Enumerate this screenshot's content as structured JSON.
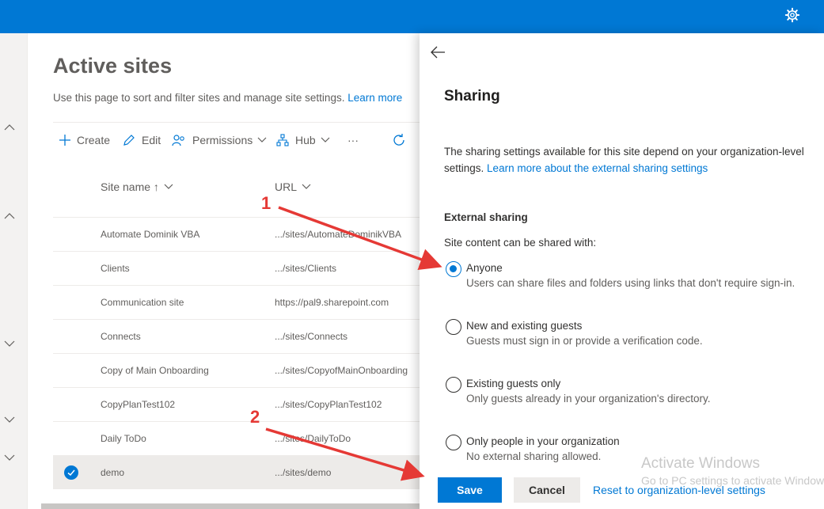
{
  "topbar": {
    "settings_icon": "gear-icon",
    "color": "#0078d4"
  },
  "main": {
    "title": "Active sites",
    "description": "Use this page to sort and filter sites and manage site settings.",
    "learn_more": "Learn more",
    "toolbar": {
      "create": "Create",
      "edit": "Edit",
      "permissions": "Permissions",
      "hub": "Hub",
      "more": "···"
    },
    "columns": {
      "site_name": "Site name ↑",
      "url": "URL"
    },
    "rows": [
      {
        "name": "Automate Dominik VBA",
        "url": ".../sites/AutomateDominikVBA",
        "selected": false
      },
      {
        "name": "Clients",
        "url": ".../sites/Clients",
        "selected": false
      },
      {
        "name": "Communication site",
        "url": "https://pal9.sharepoint.com",
        "selected": false
      },
      {
        "name": "Connects",
        "url": ".../sites/Connects",
        "selected": false
      },
      {
        "name": "Copy of Main Onboarding",
        "url": ".../sites/CopyofMainOnboarding",
        "selected": false
      },
      {
        "name": "CopyPlanTest102",
        "url": ".../sites/CopyPlanTest102",
        "selected": false
      },
      {
        "name": "Daily ToDo",
        "url": ".../sites/DailyToDo",
        "selected": false
      },
      {
        "name": "demo",
        "url": ".../sites/demo",
        "selected": true
      }
    ]
  },
  "panel": {
    "title": "Sharing",
    "description": "The sharing settings available for this site depend on your organization-level settings.",
    "description_link": "Learn more about the external sharing settings",
    "section": "External sharing",
    "group_label": "Site content can be shared with:",
    "options": [
      {
        "label": "Anyone",
        "desc": "Users can share files and folders using links that don't require sign-in.",
        "checked": true
      },
      {
        "label": "New and existing guests",
        "desc": "Guests must sign in or provide a verification code.",
        "checked": false
      },
      {
        "label": "Existing guests only",
        "desc": "Only guests already in your organization's directory.",
        "checked": false
      },
      {
        "label": "Only people in your organization",
        "desc": "No external sharing allowed.",
        "checked": false
      }
    ],
    "save": "Save",
    "cancel": "Cancel",
    "reset": "Reset to organization-level settings"
  },
  "watermark": {
    "line1": "Activate Windows",
    "line2": "Go to PC settings to activate Windows."
  },
  "annotations": {
    "arrow1_label": "1",
    "arrow2_label": "2",
    "color": "#e53935"
  }
}
